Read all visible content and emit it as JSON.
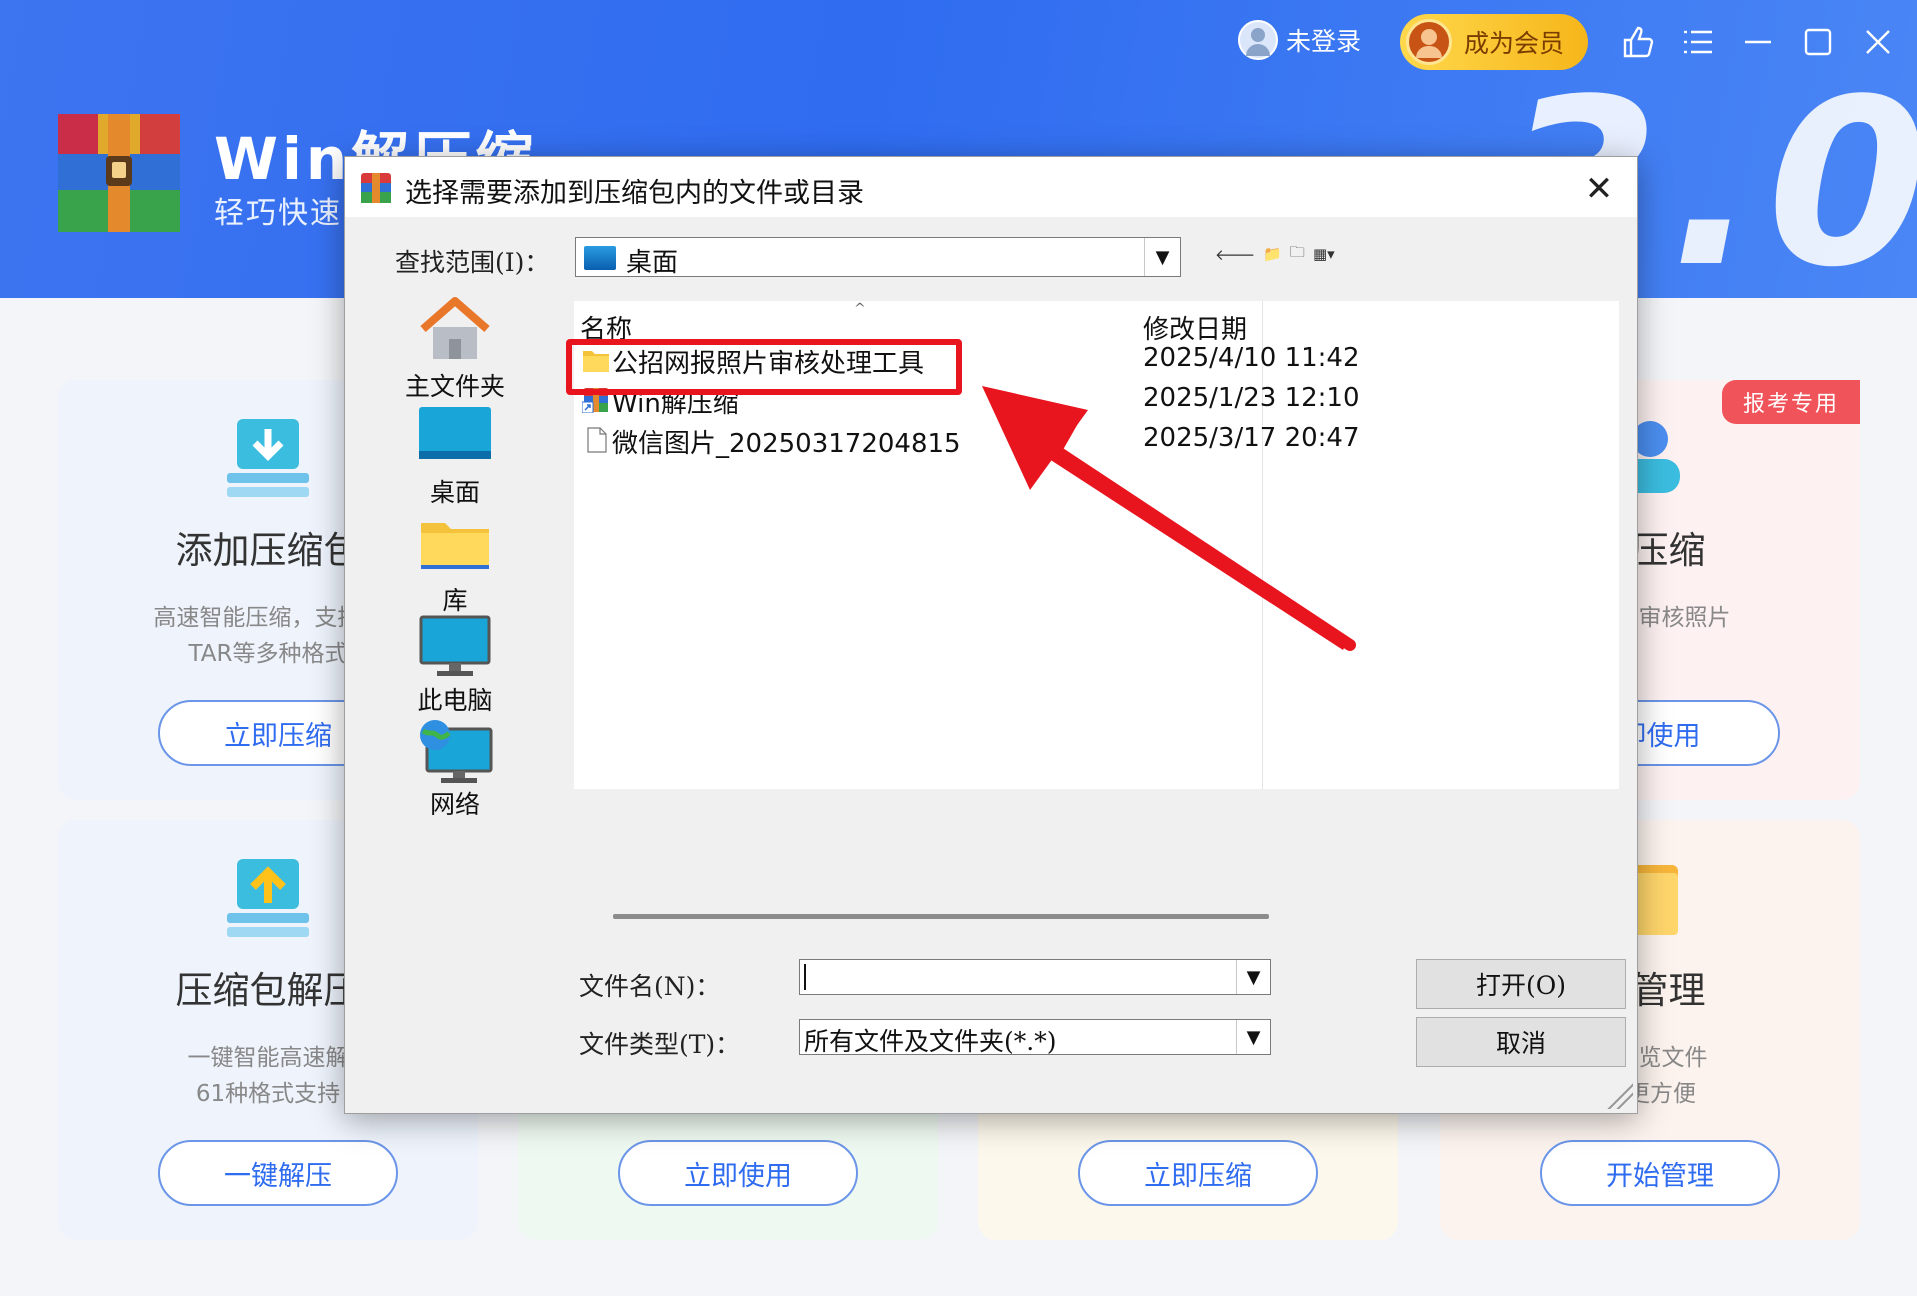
{
  "app": {
    "title": "Win解压缩",
    "subtitle": "轻巧快速",
    "version_display": "3.0",
    "user_status": "未登录",
    "vip_label": "成为会员"
  },
  "cards": [
    {
      "title": "添加压缩包",
      "desc_line1": "高速智能压缩，支持Zi",
      "desc_line2": "TAR等多种格式",
      "button": "立即压缩"
    },
    {
      "title": "照压缩",
      "desc_line1": "或报考审核照片",
      "desc_line2": "",
      "button": "即使用",
      "badge": "报考专用"
    },
    {
      "title": "压缩包解压",
      "desc_line1": "一键智能高速解",
      "desc_line2": "61种格式支持",
      "button": "一键解压"
    },
    {
      "button": "立即使用"
    },
    {
      "button": "立即压缩"
    },
    {
      "title": "件管理",
      "desc_line1": "和预览文件",
      "desc_line2": "压更方便",
      "button": "开始管理"
    }
  ],
  "dialog": {
    "title": "选择需要添加到压缩包内的文件或目录",
    "look_in_label": "查找范围(I)：",
    "look_in_value": "桌面",
    "places": [
      {
        "label": "主文件夹",
        "icon": "home-icon"
      },
      {
        "label": "桌面",
        "icon": "desktop-icon"
      },
      {
        "label": "库",
        "icon": "library-folder-icon"
      },
      {
        "label": "此电脑",
        "icon": "computer-icon"
      },
      {
        "label": "网络",
        "icon": "network-icon"
      }
    ],
    "columns": {
      "name": "名称",
      "modified": "修改日期"
    },
    "files": [
      {
        "name": "公招网报照片审核处理工具",
        "date": "2025/4/10 11:42",
        "icon": "folder-icon"
      },
      {
        "name": "Win解压缩",
        "date": "2025/1/23 12:10",
        "icon": "shortcut-app-icon"
      },
      {
        "name": "微信图片_20250317204815",
        "date": "2025/3/17 20:47",
        "icon": "file-icon"
      }
    ],
    "filename_label": "文件名(N)：",
    "filename_value": "",
    "filetype_label": "文件类型(T)：",
    "filetype_value": "所有文件及文件夹(*.*)",
    "open_button": "打开(O)",
    "cancel_button": "取消"
  },
  "colors": {
    "accent": "#2f6cf0",
    "highlight": "#e8151f",
    "vip": "#f6b61a"
  }
}
